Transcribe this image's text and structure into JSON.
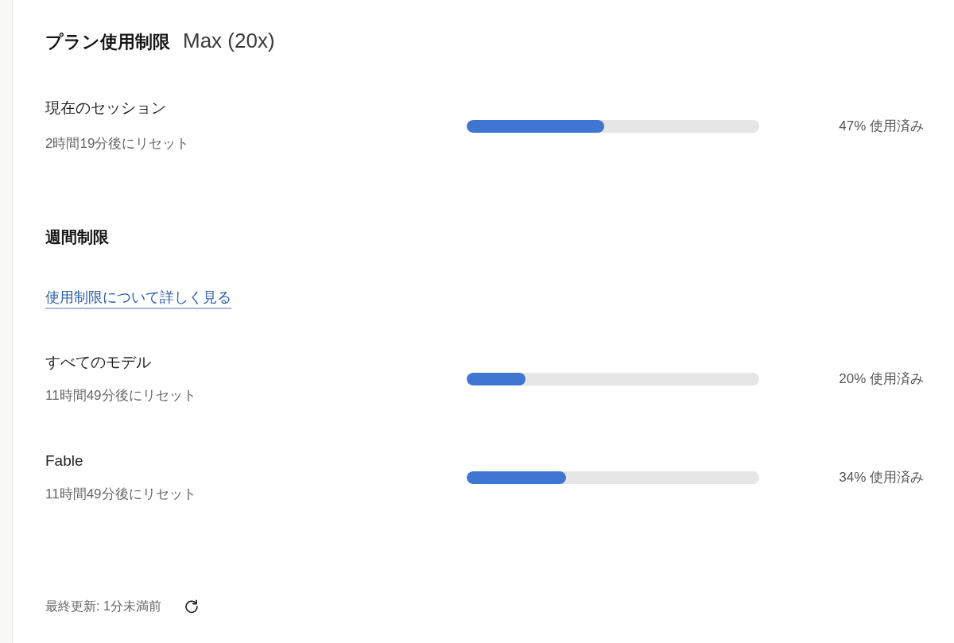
{
  "header": {
    "title": "プラン使用制限",
    "plan": "Max (20x)"
  },
  "session": {
    "label": "現在のセッション",
    "reset": "2時間19分後にリセット",
    "level": 0.47,
    "reading": "47% 使用済み"
  },
  "weekly": {
    "title": "週間制限",
    "link": "使用制限について詳しく見る",
    "limits": [
      {
        "label": "すべてのモデル",
        "reset": "11時間49分後にリセット",
        "level": 0.2,
        "reading": "20% 使用済み"
      },
      {
        "label": "Fable",
        "reset": "11時間49分後にリセット",
        "level": 0.34,
        "reading": "34% 使用済み"
      }
    ]
  },
  "footer": {
    "updated": "最終更新: 1分未満前"
  }
}
